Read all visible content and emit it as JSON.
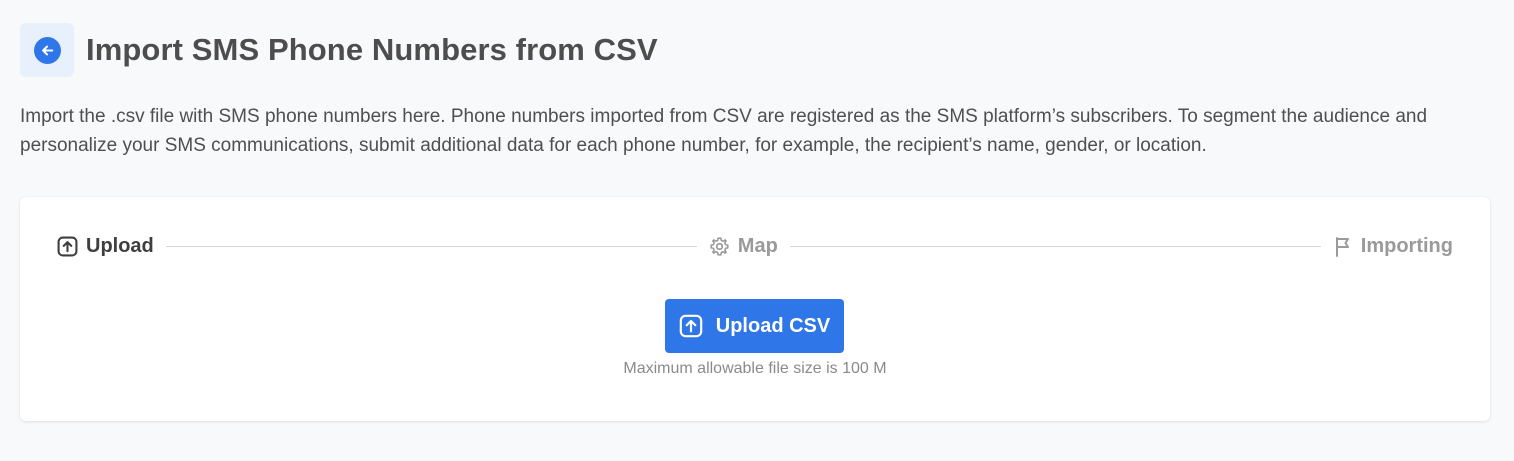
{
  "header": {
    "title": "Import SMS Phone Numbers from CSV",
    "back_icon": "arrow-left-circle-icon"
  },
  "description": "Import the .csv file with SMS phone numbers here. Phone numbers imported from CSV are registered as the SMS platform’s subscribers. To segment the audience and personalize your SMS communications, submit additional data for each phone number, for example, the recipient’s name, gender, or location.",
  "stepper": {
    "steps": [
      {
        "label": "Upload",
        "icon": "upload-icon",
        "state": "active"
      },
      {
        "label": "Map",
        "icon": "gear-icon",
        "state": "inactive"
      },
      {
        "label": "Importing",
        "icon": "flag-icon",
        "state": "inactive"
      }
    ]
  },
  "upload": {
    "button_label": "Upload CSV",
    "button_icon": "upload-icon",
    "hint": "Maximum allowable file size is 100 M"
  },
  "colors": {
    "accent": "#2f76e8",
    "background": "#f7f9fb",
    "card": "#ffffff",
    "inactive_text": "#9a9a9a"
  }
}
